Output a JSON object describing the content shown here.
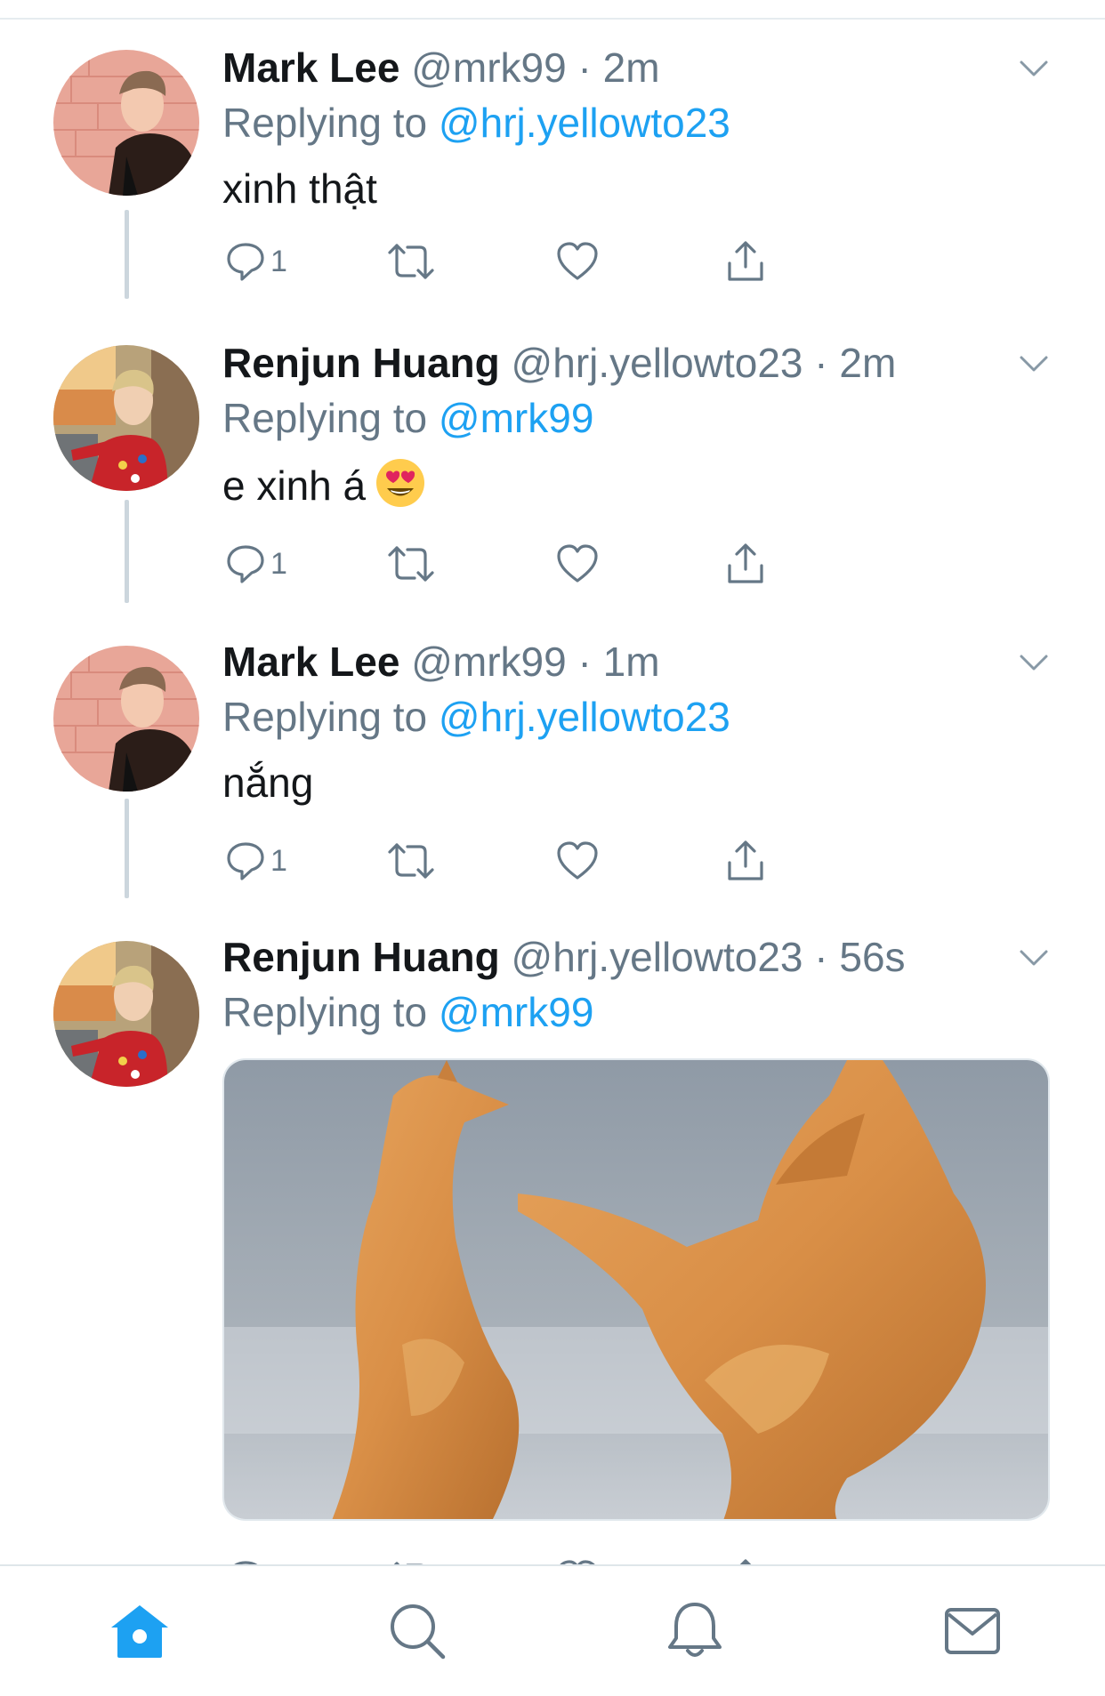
{
  "colors": {
    "accent": "#1da1f2",
    "secondary_text": "#657786",
    "primary_text": "#14171a",
    "thread_line": "#ccd6dd"
  },
  "tweets": [
    {
      "name": "Mark Lee",
      "handle": "@mrk99",
      "dot": "·",
      "time": "2m",
      "replying_prefix": "Replying to ",
      "replying_to": "@hrj.yellowto23",
      "text": "xinh thật",
      "reply_count": "1",
      "avatar": "mark-lee-avatar"
    },
    {
      "name": "Renjun Huang",
      "handle": "@hrj.yellowto23",
      "dot": "·",
      "time": "2m",
      "replying_prefix": "Replying to ",
      "replying_to": "@mrk99",
      "text": "e xinh á",
      "emoji": "heart-eyes-emoji",
      "reply_count": "1",
      "avatar": "renjun-huang-avatar"
    },
    {
      "name": "Mark Lee",
      "handle": "@mrk99",
      "dot": "·",
      "time": "1m",
      "replying_prefix": "Replying to ",
      "replying_to": "@hrj.yellowto23",
      "text": "nắng",
      "reply_count": "1",
      "avatar": "mark-lee-avatar"
    },
    {
      "name": "Renjun Huang",
      "handle": "@hrj.yellowto23",
      "dot": "·",
      "time": "56s",
      "replying_prefix": "Replying to ",
      "replying_to": "@mrk99",
      "media": "roast-chicken-photo",
      "avatar": "renjun-huang-avatar"
    }
  ],
  "tabbar": {
    "items": [
      "home-icon",
      "search-icon",
      "notifications-icon",
      "messages-icon"
    ],
    "active": "home-icon"
  }
}
